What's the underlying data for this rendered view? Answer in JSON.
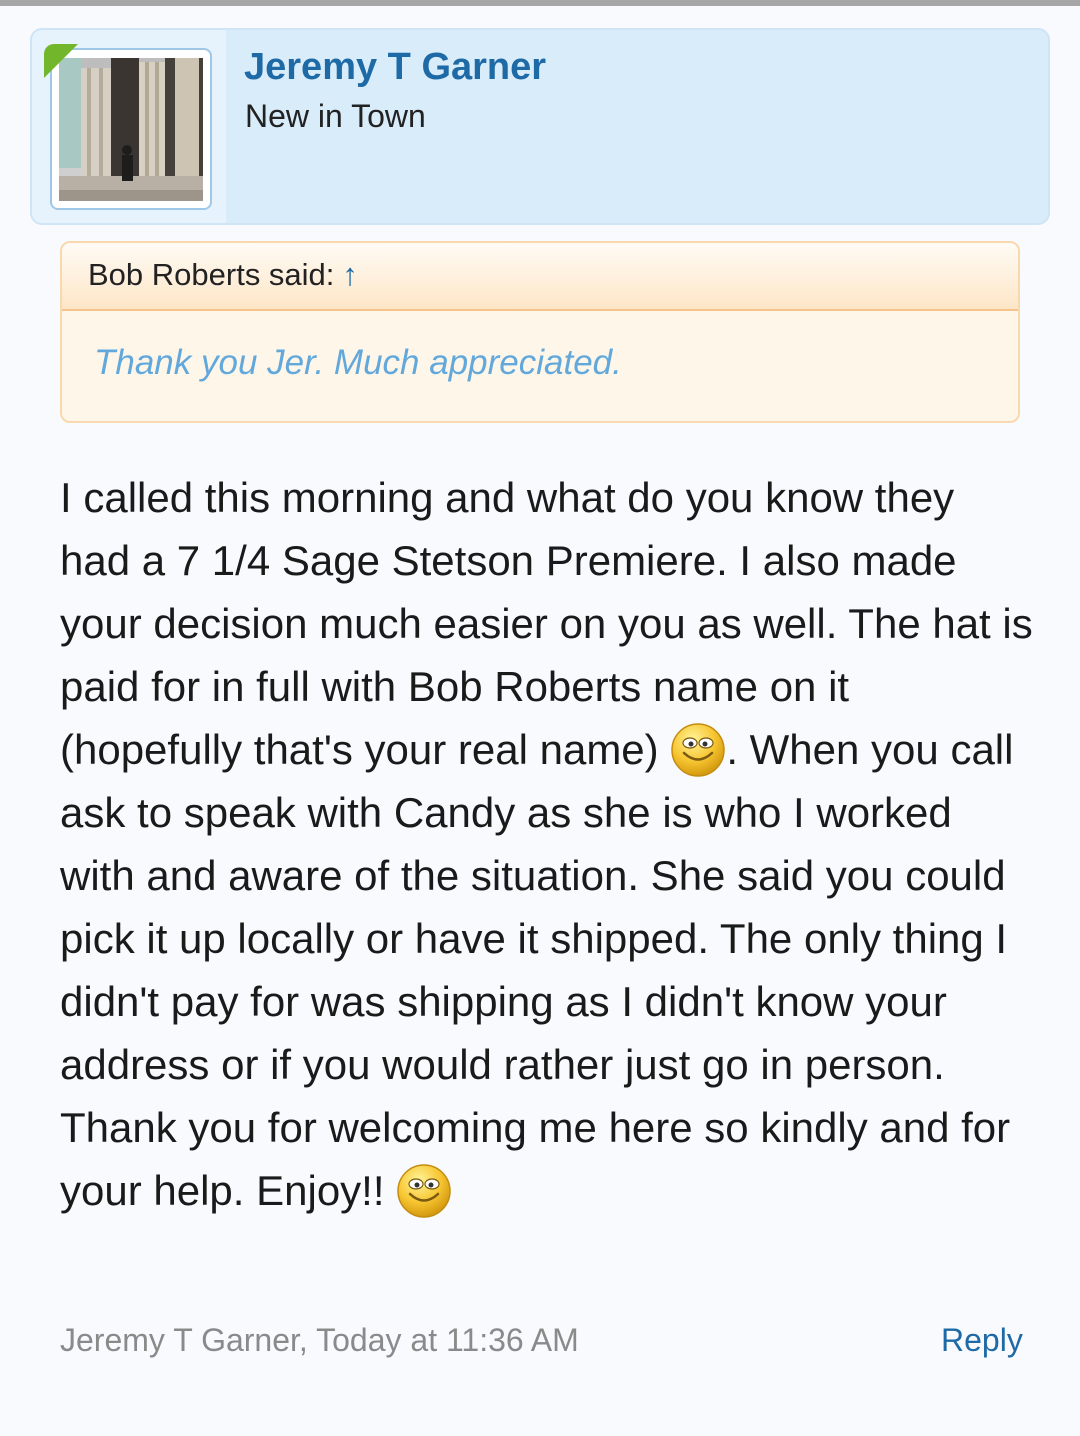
{
  "post": {
    "author_name": "Jeremy T Garner",
    "author_title": "New in Town",
    "quote": {
      "attribution": "Bob Roberts said:",
      "arrow": "↑",
      "text": "Thank you Jer. Much appreciated."
    },
    "message": {
      "part1": "I called this morning and what do you know they had a 7 1/4 Sage Stetson Premiere. I also made your decision much easier on you as well. The hat is paid for in full with Bob Roberts name on it (hopefully that's your real name)",
      "part2": ". When you call ask to speak with Candy as she is who I worked with and aware of the situation. She said you could pick it up locally or have it shipped. The only thing I didn't pay for was shipping as I didn't know your address or if you would rather just go in person. Thank you for welcoming me here so kindly and for your help. Enjoy!!"
    },
    "meta": "Jeremy T Garner, Today at 11:36 AM",
    "reply_label": "Reply"
  },
  "colors": {
    "link": "#1e6aa6",
    "quote_text": "#62a8db",
    "header_bg": "#d8ecfa",
    "quote_bg": "#fff6ea"
  },
  "icons": {
    "smiley": "smiley-icon"
  }
}
